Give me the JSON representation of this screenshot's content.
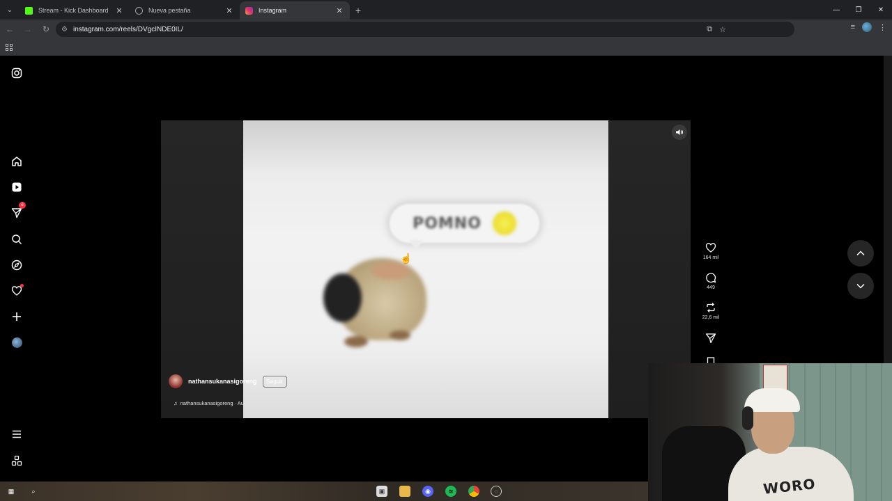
{
  "browser": {
    "tabs": [
      {
        "title": "Stream - Kick Dashboard",
        "favicon": "kick-icon",
        "color": "#53fc18",
        "active": false
      },
      {
        "title": "Nueva pestaña",
        "favicon": "globe-icon",
        "color": "#9aa0a6",
        "active": false
      },
      {
        "title": "Instagram",
        "favicon": "instagram-icon",
        "color": "#e1306c",
        "active": true
      }
    ],
    "url": "instagram.com/reels/DVgcINDE0IL/"
  },
  "sidebar": {
    "items": [
      {
        "name": "instagram-logo-icon"
      },
      {
        "name": "home-icon"
      },
      {
        "name": "reels-icon"
      },
      {
        "name": "messages-icon",
        "badge": "6"
      },
      {
        "name": "search-icon"
      },
      {
        "name": "explore-icon"
      },
      {
        "name": "notifications-icon"
      },
      {
        "name": "create-icon"
      },
      {
        "name": "profile-avatar"
      },
      {
        "name": "more-menu-icon"
      },
      {
        "name": "meta-apps-icon"
      }
    ]
  },
  "reel": {
    "bubble_text": "POMNO",
    "author": "nathansukanasigoreng",
    "follow_label": "Seguir",
    "audio_label": "nathansukanasigoreng · Audio original",
    "likes": "164 mil",
    "comments": "449",
    "reposts": "22,6 mil"
  },
  "webcam": {
    "hoodie_text": "WORO"
  },
  "colors": {
    "accent_red": "#ff3040",
    "page_bg": "#000000",
    "chrome_bg": "#35363a"
  }
}
